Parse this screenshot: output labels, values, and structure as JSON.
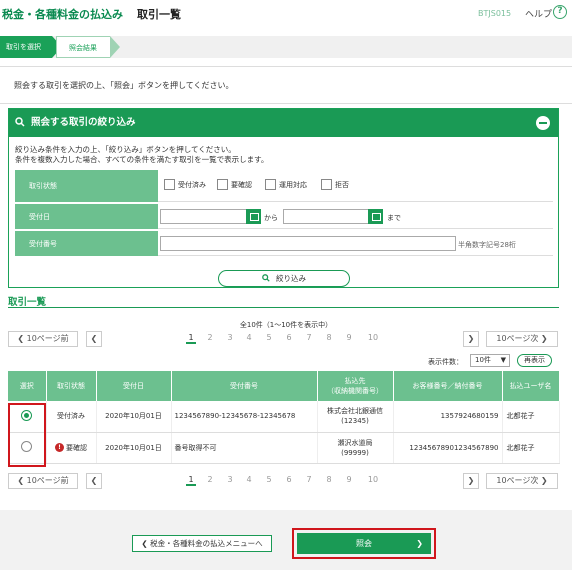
{
  "header": {
    "title": "税金・各種料金の払込み",
    "page": "取引一覧",
    "code": "BTJS015",
    "help": "ヘルプ",
    "help_icon": "?"
  },
  "steps": [
    "取引を選択",
    "照会結果"
  ],
  "intro": "照会する取引を選択の上、「照会」ボタンを押してください。",
  "filter": {
    "title": "照会する取引の絞り込み",
    "desc1": "絞り込み条件を入力の上、「絞り込み」ボタンを押してください。",
    "desc2": "条件を複数入力した場合、すべての条件を満たす取引を一覧で表示します。",
    "status_label": "取引状態",
    "status_options": [
      "受付済み",
      "要確認",
      "運用対応",
      "拒否"
    ],
    "date_label": "受付日",
    "date_from": "から",
    "date_to": "まで",
    "no_label": "受付番号",
    "no_hint": "半角数字記号28桁",
    "button": "絞り込み"
  },
  "list": {
    "title": "取引一覧",
    "count": "全10件（1～10件を表示中）",
    "prev10": "10ページ前",
    "next10": "10ページ次",
    "pages": [
      "1",
      "2",
      "3",
      "4",
      "5",
      "6",
      "7",
      "8",
      "9",
      "10"
    ],
    "display_label": "表示件数：",
    "display_value": "10件",
    "redisplay": "再表示",
    "columns": [
      "選択",
      "取引状態",
      "受付日",
      "受付番号",
      "払込先\n（収納機関番号）",
      "お客様番号／納付番号",
      "払込ユーザ名"
    ],
    "rows": [
      {
        "status": "受付済み",
        "date": "2020年10月01日",
        "no": "1234567890-12345678-12345678",
        "payee": "株式会社北銀通信",
        "payee_no": "(12345)",
        "cust": "1357924680159",
        "user": "北都花子"
      },
      {
        "status": "要確認",
        "date": "2020年10月01日",
        "no": "番号取得不可",
        "payee": "瀬沢水道局",
        "payee_no": "(99999)",
        "cust": "12345678901234567890",
        "user": "北都花子"
      }
    ]
  },
  "buttons": {
    "menu": "税金・各種料金の払込メニューへ",
    "submit": "照会"
  },
  "colors": {
    "accent": "#1a9a55",
    "label_bg": "#6cc08f",
    "highlight": "#d0161c"
  }
}
